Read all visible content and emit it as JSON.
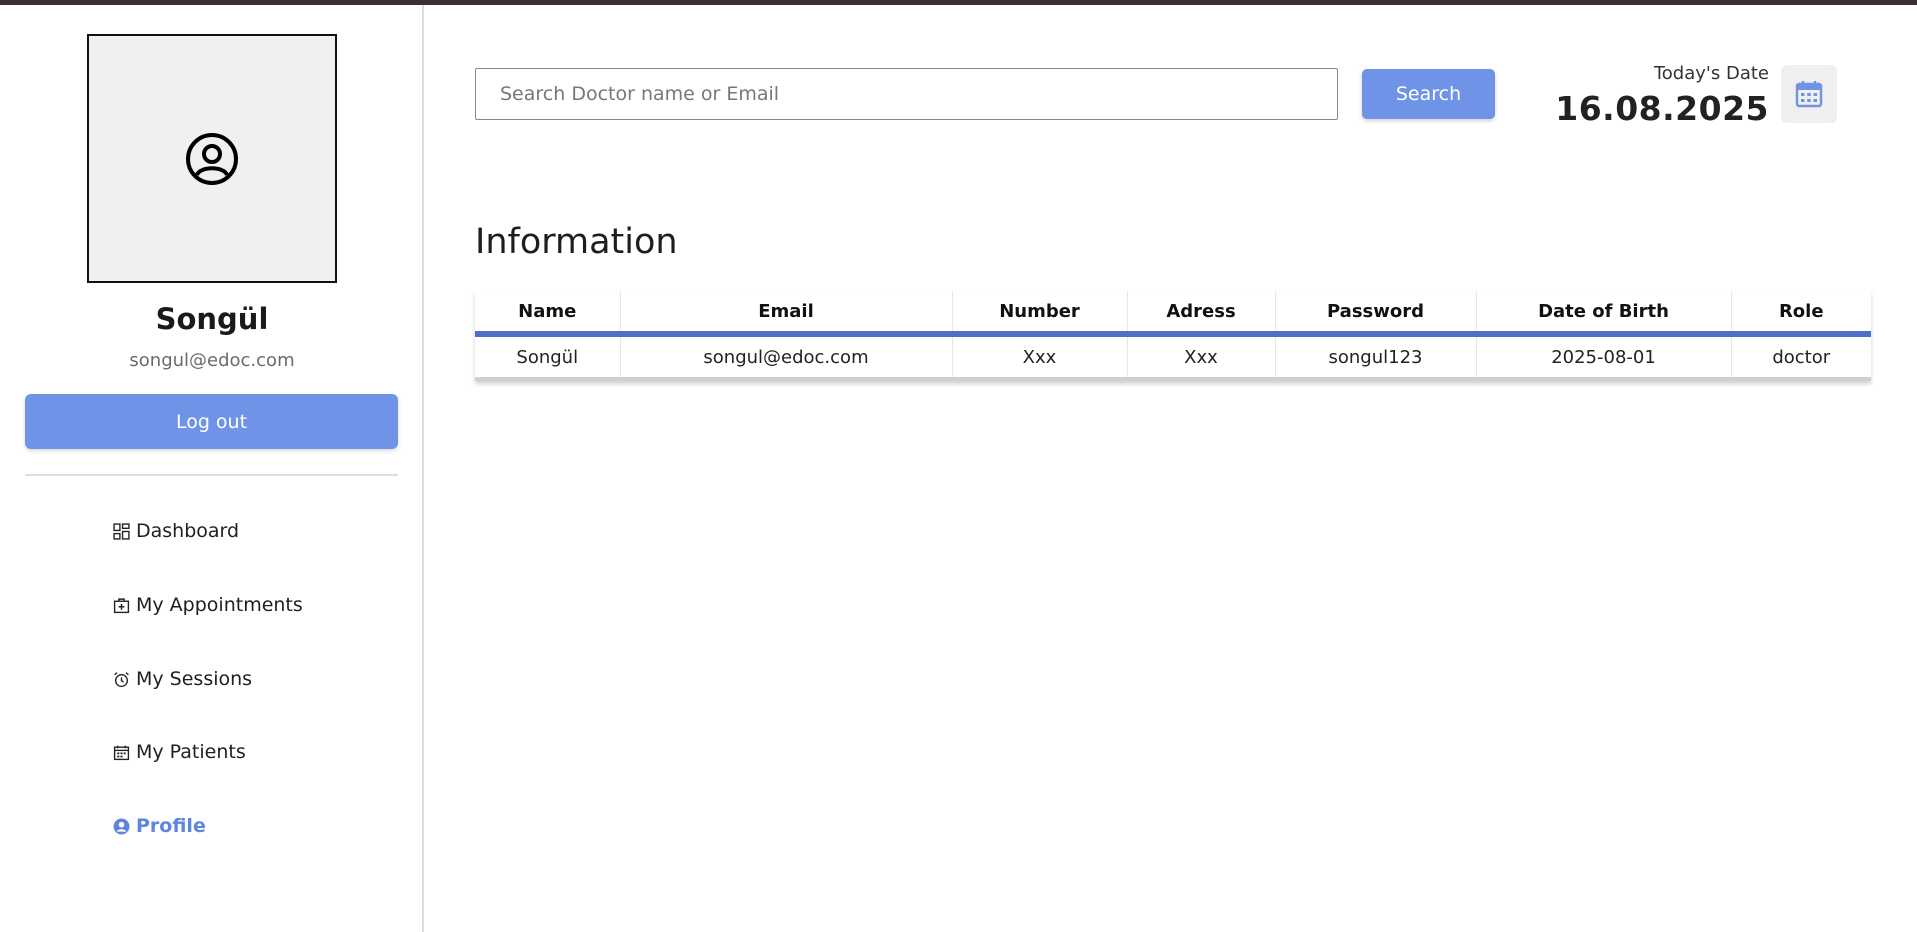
{
  "profile": {
    "name": "Songül",
    "email": "songul@edoc.com",
    "logout_label": "Log out",
    "avatar_icon": "user-circle-icon"
  },
  "nav": {
    "items": [
      {
        "label": "Dashboard",
        "icon": "dashboard-grid-icon",
        "active": false
      },
      {
        "label": "My Appointments",
        "icon": "medical-bag-icon",
        "active": false
      },
      {
        "label": "My Sessions",
        "icon": "alarm-clock-icon",
        "active": false
      },
      {
        "label": "My Patients",
        "icon": "calendar-icon",
        "active": false
      },
      {
        "label": "Profile",
        "icon": "user-circle-icon",
        "active": true
      }
    ]
  },
  "search": {
    "placeholder": "Search Doctor name or Email",
    "value": "",
    "button_label": "Search"
  },
  "date": {
    "label": "Today's Date",
    "value": "16.08.2025",
    "icon": "calendar-icon"
  },
  "info": {
    "title": "Information",
    "columns": [
      "Name",
      "Email",
      "Number",
      "Adress",
      "Password",
      "Date of Birth",
      "Role"
    ],
    "rows": [
      [
        "Songül",
        "songul@edoc.com",
        "Xxx",
        "Xxx",
        "songul123",
        "2025-08-01",
        "doctor"
      ]
    ]
  },
  "colors": {
    "accent": "#6f93e6",
    "table_header_border": "#4f6fc9",
    "active_nav": "#5e86e0"
  }
}
